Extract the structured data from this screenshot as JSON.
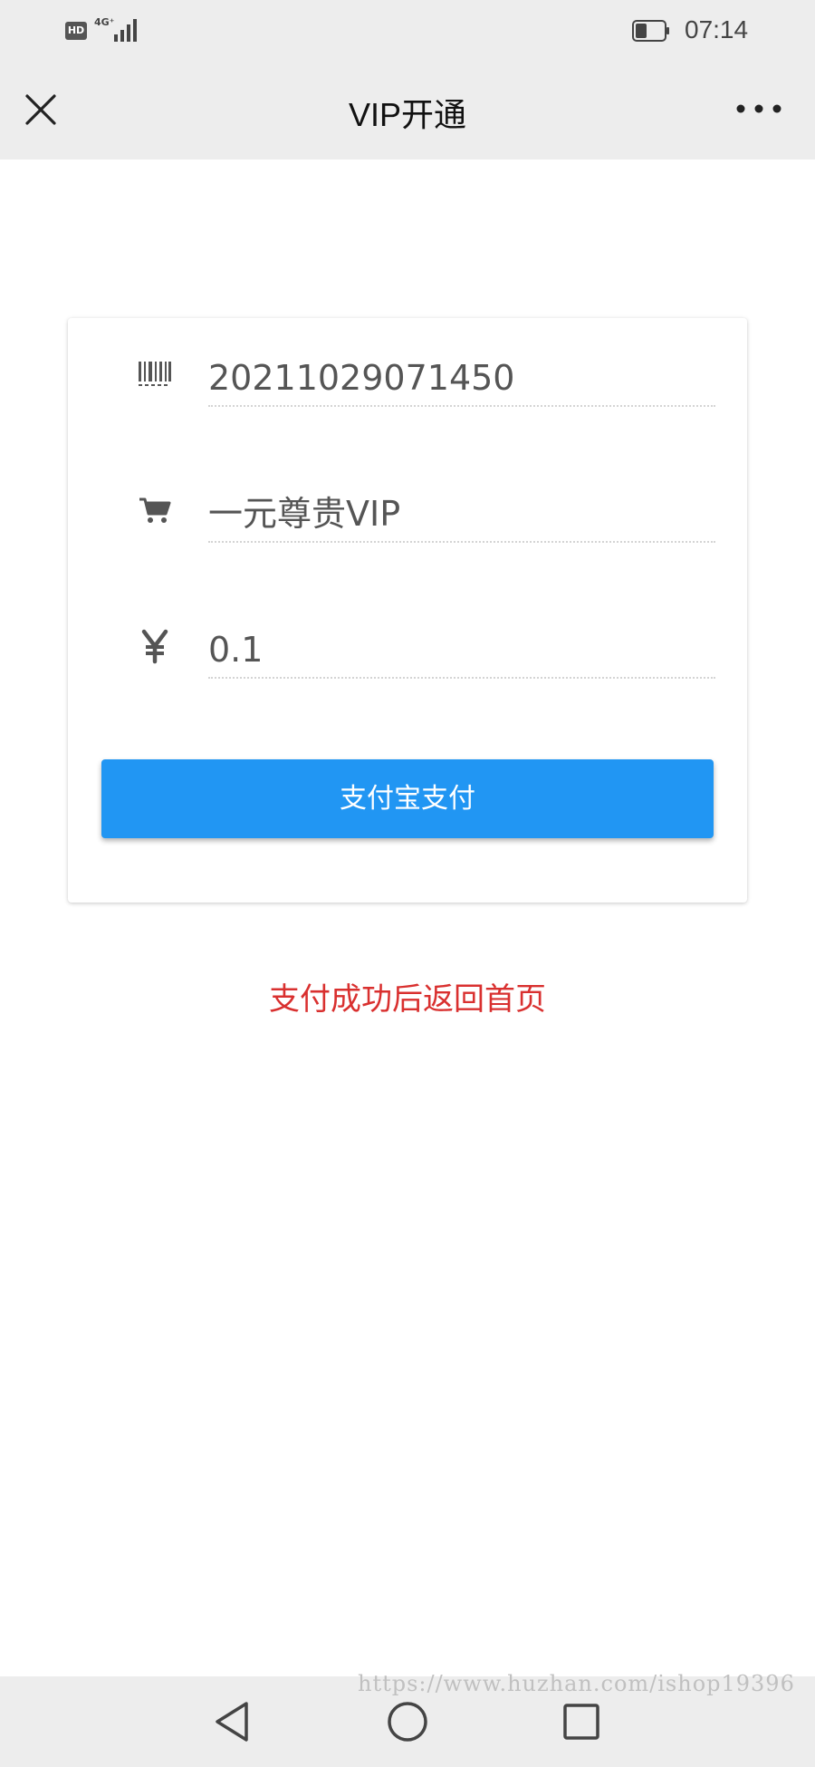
{
  "status_bar": {
    "hd_label": "HD",
    "network_label": "4G⁺",
    "time": "07:14"
  },
  "header": {
    "title": "VIP开通",
    "close_icon": "close-icon",
    "more_icon": "more-dots-icon"
  },
  "form": {
    "order_number": "20211029071450",
    "product_name": "一元尊贵VIP",
    "amount": "0.1",
    "pay_button_label": "支付宝支付",
    "icons": [
      "barcode-icon",
      "cart-icon",
      "yen-icon"
    ]
  },
  "return_text": "支付成功后返回首页",
  "watermark": "https://www.huzhan.com/ishop19396",
  "colors": {
    "accent": "#2196f3",
    "return_text": "#d9302f",
    "bar_bg": "#ededed"
  }
}
